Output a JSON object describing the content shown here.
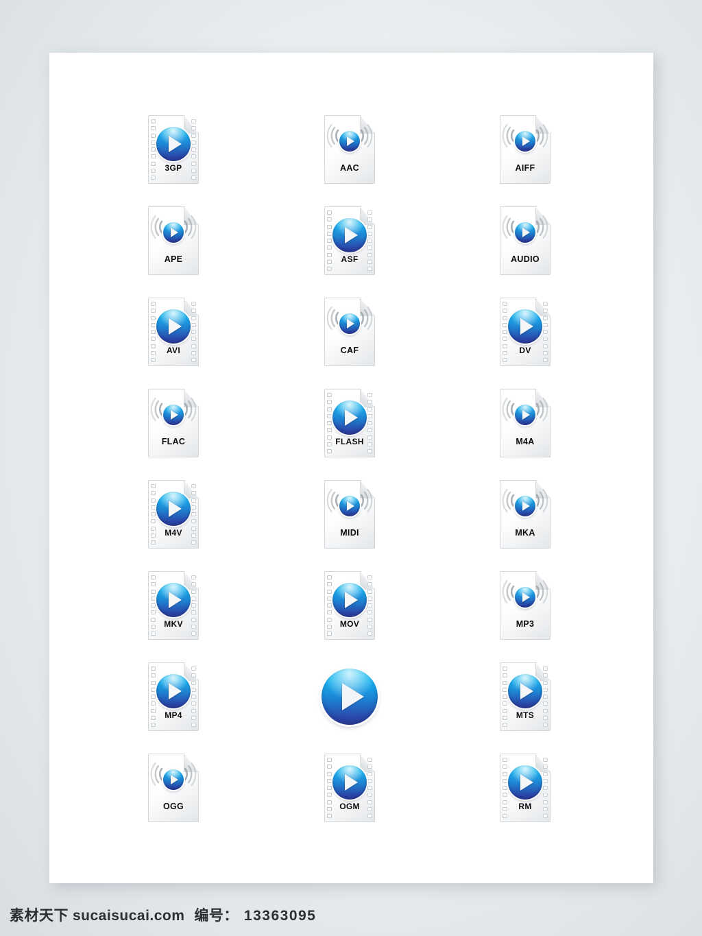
{
  "canvas": {
    "background_color": "#ffffff",
    "page_background_color": "#e6eaec"
  },
  "grid": {
    "columns": 3,
    "rows": 8,
    "icons": [
      {
        "label": "3GP",
        "type": "video"
      },
      {
        "label": "AAC",
        "type": "audio"
      },
      {
        "label": "AIFF",
        "type": "audio"
      },
      {
        "label": "APE",
        "type": "audio"
      },
      {
        "label": "ASF",
        "type": "video"
      },
      {
        "label": "AUDIO",
        "type": "audio"
      },
      {
        "label": "AVI",
        "type": "video"
      },
      {
        "label": "CAF",
        "type": "audio"
      },
      {
        "label": "DV",
        "type": "video"
      },
      {
        "label": "FLAC",
        "type": "audio"
      },
      {
        "label": "FLASH",
        "type": "video"
      },
      {
        "label": "M4A",
        "type": "audio"
      },
      {
        "label": "M4V",
        "type": "video"
      },
      {
        "label": "MIDI",
        "type": "audio"
      },
      {
        "label": "MKA",
        "type": "audio"
      },
      {
        "label": "MKV",
        "type": "video"
      },
      {
        "label": "MOV",
        "type": "video"
      },
      {
        "label": "MP3",
        "type": "audio"
      },
      {
        "label": "MP4",
        "type": "video"
      },
      {
        "label": "",
        "type": "playbutton"
      },
      {
        "label": "MTS",
        "type": "video"
      },
      {
        "label": "OGG",
        "type": "audio"
      },
      {
        "label": "OGM",
        "type": "video"
      },
      {
        "label": "RM",
        "type": "video"
      }
    ]
  },
  "icon_style": {
    "play_icon_name": "play-triangle-icon",
    "disc_gradient_top": "#15c2f0",
    "disc_gradient_bottom": "#2b3c96",
    "triangle_color": "#f4f6f8",
    "page_color": "#ffffff",
    "label_color": "#0d0d0d"
  },
  "footer": {
    "brand": "素材天下",
    "site": "sucaisucai.com",
    "number_label": "编号：",
    "number_value": "13363095"
  }
}
